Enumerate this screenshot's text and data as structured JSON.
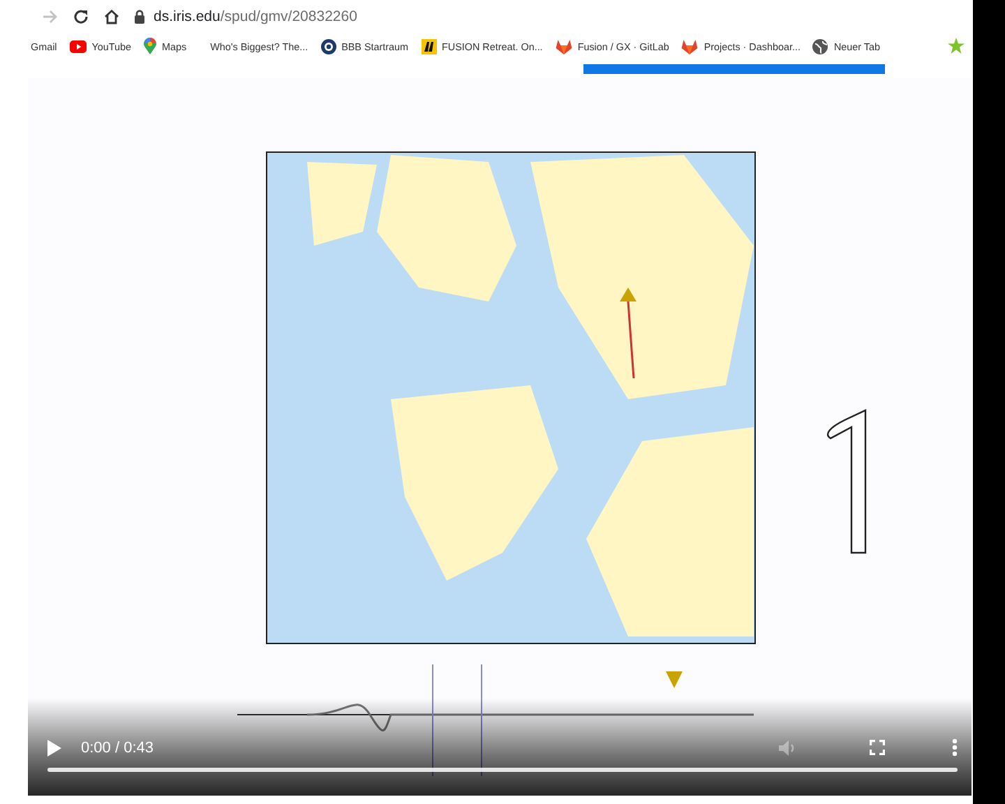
{
  "toolbar": {
    "forward_disabled": true,
    "url_host": "ds.iris.edu",
    "url_path": "/spud/gmv/20832260"
  },
  "bookmarks": [
    {
      "label": "Gmail",
      "kind": "plain"
    },
    {
      "label": "YouTube",
      "kind": "video"
    },
    {
      "label": "Maps",
      "kind": "pin"
    },
    {
      "label": "Who's Biggest? The...",
      "kind": "plain"
    },
    {
      "label": "BBB Startraum",
      "kind": "ring"
    },
    {
      "label": "FUSION Retreat. On...",
      "kind": "square"
    },
    {
      "label": "Fusion / GX · GitLab",
      "kind": "fox"
    },
    {
      "label": "Projects · Dashboar...",
      "kind": "fox"
    },
    {
      "label": "Neuer Tab",
      "kind": "globe"
    }
  ],
  "video": {
    "kind": "picture",
    "time": "0:00 / 0:43",
    "level": 0,
    "volume_disabled": true
  }
}
